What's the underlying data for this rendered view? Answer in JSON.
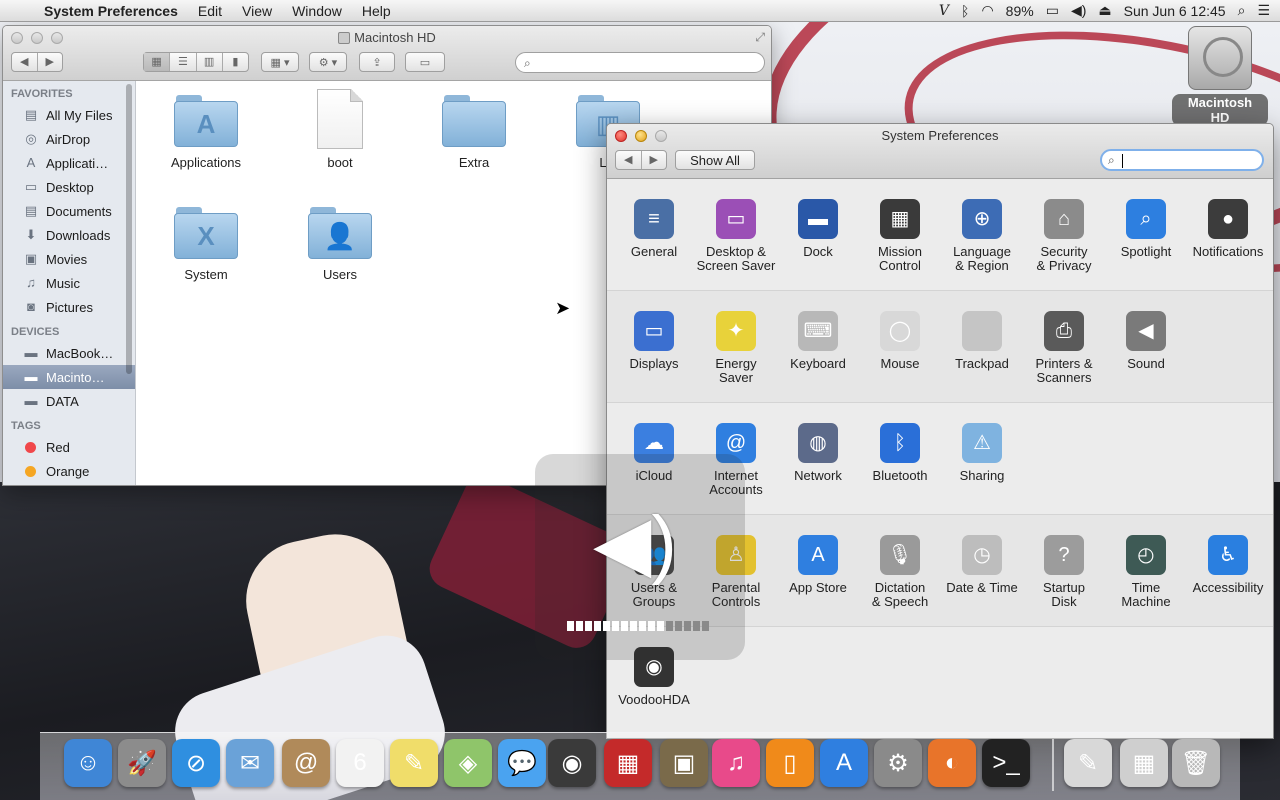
{
  "menubar": {
    "app_name": "System Preferences",
    "menus": [
      "Edit",
      "View",
      "Window",
      "Help"
    ],
    "battery": "89%",
    "datetime": "Sun Jun 6  12:45"
  },
  "desktop": {
    "disk_label": "Macintosh HD"
  },
  "finder": {
    "title": "Macintosh HD",
    "sidebar": {
      "favorites_header": "FAVORITES",
      "favorites": [
        {
          "label": "All My Files",
          "icon": "all-files-icon",
          "glyph": "▤"
        },
        {
          "label": "AirDrop",
          "icon": "airdrop-icon",
          "glyph": "◎"
        },
        {
          "label": "Applicati…",
          "icon": "applications-icon",
          "glyph": "A"
        },
        {
          "label": "Desktop",
          "icon": "desktop-icon",
          "glyph": "▭"
        },
        {
          "label": "Documents",
          "icon": "documents-icon",
          "glyph": "▤"
        },
        {
          "label": "Downloads",
          "icon": "downloads-icon",
          "glyph": "⬇"
        },
        {
          "label": "Movies",
          "icon": "movies-icon",
          "glyph": "▣"
        },
        {
          "label": "Music",
          "icon": "music-icon",
          "glyph": "♫"
        },
        {
          "label": "Pictures",
          "icon": "pictures-icon",
          "glyph": "◙"
        }
      ],
      "devices_header": "DEVICES",
      "devices": [
        {
          "label": "MacBook…",
          "icon": "laptop-icon",
          "glyph": "▬"
        },
        {
          "label": "Macinto…",
          "icon": "disk-icon",
          "glyph": "▬"
        },
        {
          "label": "DATA",
          "icon": "disk-icon",
          "glyph": "▬"
        }
      ],
      "tags_header": "TAGS",
      "tags": [
        {
          "label": "Red",
          "color": "#f0474a"
        },
        {
          "label": "Orange",
          "color": "#f5a623"
        }
      ]
    },
    "items": [
      {
        "label": "Applications",
        "kind": "folder",
        "glyph": "A"
      },
      {
        "label": "boot",
        "kind": "document",
        "glyph": ""
      },
      {
        "label": "Extra",
        "kind": "folder",
        "glyph": ""
      },
      {
        "label": "Lib",
        "kind": "folder",
        "glyph": "▥"
      },
      {
        "label": "System",
        "kind": "folder",
        "glyph": "X"
      },
      {
        "label": "Users",
        "kind": "folder",
        "glyph": "👤"
      }
    ]
  },
  "sysprefs": {
    "title": "System Preferences",
    "show_all": "Show All",
    "search_value": "",
    "rows": [
      [
        {
          "label": "General",
          "icon": "general-icon",
          "color": "#4a6fa5",
          "glyph": "≡"
        },
        {
          "label": "Desktop &\nScreen Saver",
          "icon": "desktop-screensaver-icon",
          "color": "#9b4fb6",
          "glyph": "▭"
        },
        {
          "label": "Dock",
          "icon": "dock-icon",
          "color": "#2a58a8",
          "glyph": "▬"
        },
        {
          "label": "Mission\nControl",
          "icon": "mission-control-icon",
          "color": "#3a3a3a",
          "glyph": "▦"
        },
        {
          "label": "Language\n& Region",
          "icon": "language-region-icon",
          "color": "#3d6cb5",
          "glyph": "⊕"
        },
        {
          "label": "Security\n& Privacy",
          "icon": "security-icon",
          "color": "#8b8b8b",
          "glyph": "⌂"
        },
        {
          "label": "Spotlight",
          "icon": "spotlight-icon",
          "color": "#2d7fe0",
          "glyph": "⌕"
        },
        {
          "label": "Notifications",
          "icon": "notifications-icon",
          "color": "#3c3c3c",
          "glyph": "●"
        }
      ],
      [
        {
          "label": "Displays",
          "icon": "displays-icon",
          "color": "#3b6fd0",
          "glyph": "▭"
        },
        {
          "label": "Energy\nSaver",
          "icon": "energy-saver-icon",
          "color": "#e8d23a",
          "glyph": "✦"
        },
        {
          "label": "Keyboard",
          "icon": "keyboard-icon",
          "color": "#b8b8b8",
          "glyph": "⌨"
        },
        {
          "label": "Mouse",
          "icon": "mouse-icon",
          "color": "#d8d8d8",
          "glyph": "◯"
        },
        {
          "label": "Trackpad",
          "icon": "trackpad-icon",
          "color": "#c5c5c5",
          "glyph": ""
        },
        {
          "label": "Printers &\nScanners",
          "icon": "printers-scanners-icon",
          "color": "#5a5a5a",
          "glyph": "⎙"
        },
        {
          "label": "Sound",
          "icon": "sound-icon",
          "color": "#7a7a7a",
          "glyph": "◀"
        }
      ],
      [
        {
          "label": "iCloud",
          "icon": "icloud-icon",
          "color": "#3b7fe0",
          "glyph": "☁"
        },
        {
          "label": "Internet\nAccounts",
          "icon": "internet-accounts-icon",
          "color": "#2f7fe0",
          "glyph": "@"
        },
        {
          "label": "Network",
          "icon": "network-icon",
          "color": "#5c6a8a",
          "glyph": "◍"
        },
        {
          "label": "Bluetooth",
          "icon": "bluetooth-icon",
          "color": "#2a6fd8",
          "glyph": "ᛒ"
        },
        {
          "label": "Sharing",
          "icon": "sharing-icon",
          "color": "#7fb3e0",
          "glyph": "⚠"
        }
      ],
      [
        {
          "label": "Users &\nGroups",
          "icon": "users-groups-icon",
          "color": "#4b4b4b",
          "glyph": "👥"
        },
        {
          "label": "Parental\nControls",
          "icon": "parental-controls-icon",
          "color": "#e3c12f",
          "glyph": "♙"
        },
        {
          "label": "App Store",
          "icon": "app-store-icon",
          "color": "#2f7fe0",
          "glyph": "A"
        },
        {
          "label": "Dictation\n& Speech",
          "icon": "dictation-speech-icon",
          "color": "#9a9a9a",
          "glyph": "🎙"
        },
        {
          "label": "Date & Time",
          "icon": "date-time-icon",
          "color": "#bdbdbd",
          "glyph": "◷"
        },
        {
          "label": "Startup\nDisk",
          "icon": "startup-disk-icon",
          "color": "#9c9c9c",
          "glyph": "?"
        },
        {
          "label": "Time\nMachine",
          "icon": "time-machine-icon",
          "color": "#3e5a55",
          "glyph": "◴"
        },
        {
          "label": "Accessibility",
          "icon": "accessibility-icon",
          "color": "#2a7fe0",
          "glyph": "♿"
        }
      ],
      [
        {
          "label": "VoodooHDA",
          "icon": "voodoohda-icon",
          "color": "#333333",
          "glyph": "◉"
        }
      ]
    ]
  },
  "volume_hud": {
    "level_bars_on": 11,
    "level_bars_total": 16
  },
  "dock": [
    {
      "name": "finder-icon",
      "color": "#3f86d6",
      "glyph": "☺"
    },
    {
      "name": "launchpad-icon",
      "color": "#8c8c8c",
      "glyph": "🚀"
    },
    {
      "name": "safari-icon",
      "color": "#2f8fe0",
      "glyph": "⊘"
    },
    {
      "name": "mail-icon",
      "color": "#6aa2d8",
      "glyph": "✉"
    },
    {
      "name": "contacts-icon",
      "color": "#b08a5a",
      "glyph": "@"
    },
    {
      "name": "calendar-icon",
      "color": "#f2f2f2",
      "glyph": "6"
    },
    {
      "name": "notes-icon",
      "color": "#f0dd6a",
      "glyph": "✎"
    },
    {
      "name": "maps-icon",
      "color": "#8fc56a",
      "glyph": "◈"
    },
    {
      "name": "messages-icon",
      "color": "#4aa3f0",
      "glyph": "💬"
    },
    {
      "name": "facetime-icon",
      "color": "#3a3a3a",
      "glyph": "◉"
    },
    {
      "name": "photo-booth-icon",
      "color": "#c42a2a",
      "glyph": "▦"
    },
    {
      "name": "iphoto-icon",
      "color": "#7a6a4a",
      "glyph": "▣"
    },
    {
      "name": "itunes-icon",
      "color": "#e84a8a",
      "glyph": "♫"
    },
    {
      "name": "ibooks-icon",
      "color": "#f08a1a",
      "glyph": "▯"
    },
    {
      "name": "app-store-dock-icon",
      "color": "#2f7fe0",
      "glyph": "A"
    },
    {
      "name": "system-preferences-dock-icon",
      "color": "#8a8a8a",
      "glyph": "⚙"
    },
    {
      "name": "firefox-icon",
      "color": "#e8742a",
      "glyph": "◐"
    },
    {
      "name": "terminal-icon",
      "color": "#222222",
      "glyph": ">_"
    },
    {
      "name": "script-editor-icon",
      "color": "#d8d8d8",
      "glyph": "✎"
    },
    {
      "name": "downloads-stack-icon",
      "color": "#cfcfcf",
      "glyph": "▦"
    },
    {
      "name": "trash-icon",
      "color": "#b8b8b8",
      "glyph": "🗑"
    }
  ]
}
